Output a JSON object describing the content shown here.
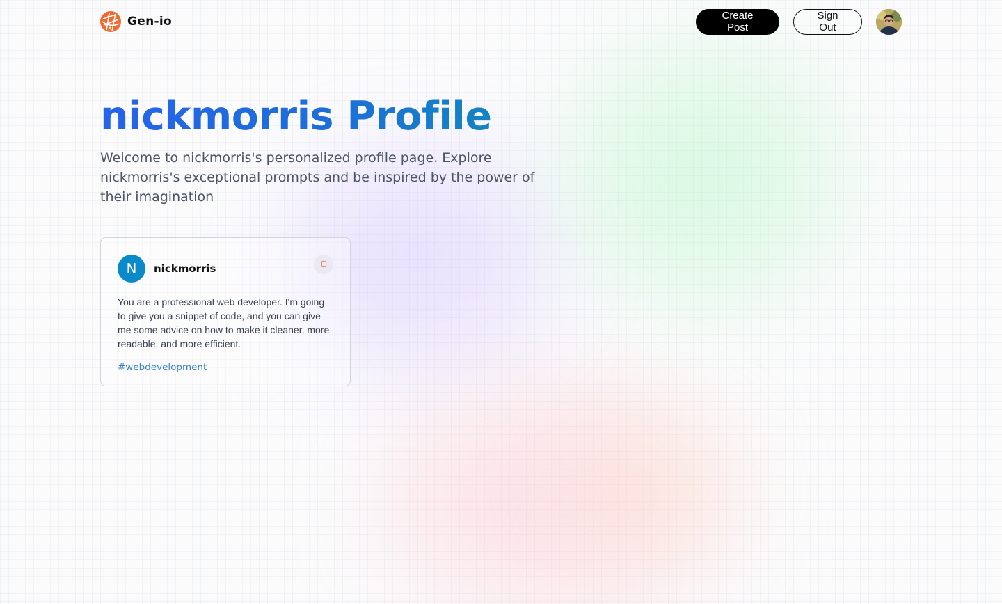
{
  "brand": {
    "name": "Gen-io"
  },
  "nav": {
    "create_label": "Create Post",
    "signout_label": "Sign Out"
  },
  "hero": {
    "title": "nickmorris Profile",
    "subtitle": "Welcome to nickmorris's personalized profile page. Explore nickmorris's exceptional prompts and be inspired by the power of their imagination"
  },
  "posts": [
    {
      "avatar_initial": "N",
      "username": "nickmorris",
      "prompt": "You are a professional web developer. I'm going to give you a snippet of code, and you can give me some advice on how to make it cleaner, more readable, and more efficient.",
      "tag": "#webdevelopment"
    }
  ],
  "colors": {
    "brand_orange": "#f26a2e",
    "title_gradient_start": "#2563eb",
    "title_gradient_end": "#0e8fb6",
    "avatar_blue": "#0a8acb",
    "tag_blue": "#3b82c4"
  },
  "icons": {
    "logo": "globe-logo-icon",
    "copy": "copy-icon",
    "profile": "user-avatar"
  }
}
